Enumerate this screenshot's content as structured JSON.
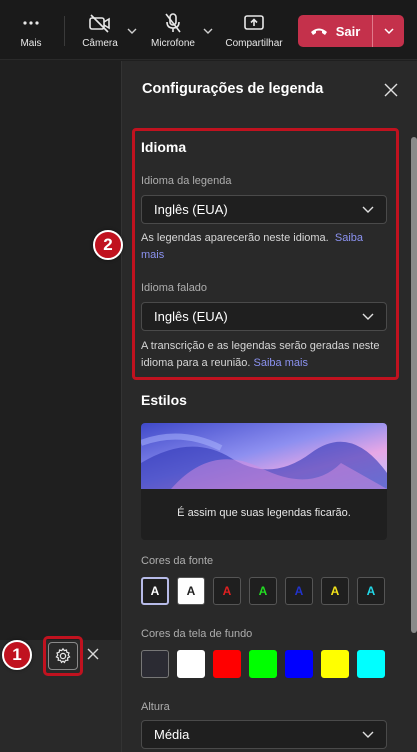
{
  "toolbar": {
    "more_label": "Mais",
    "camera_label": "Câmera",
    "mic_label": "Microfone",
    "share_label": "Compartilhar",
    "leave_label": "Sair"
  },
  "panel": {
    "title": "Configurações de legenda",
    "language": {
      "section_title": "Idioma",
      "caption_lang_label": "Idioma da legenda",
      "caption_lang_value": "Inglês (EUA)",
      "caption_help": "As legendas aparecerão neste idioma.",
      "caption_help_link": "Saiba mais",
      "spoken_lang_label": "Idioma falado",
      "spoken_lang_value": "Inglês (EUA)",
      "spoken_help": "A transcrição e as legendas serão geradas neste idioma para a reunião.",
      "spoken_help_link": "Saiba mais"
    },
    "styles": {
      "section_title": "Estilos",
      "preview_text": "É assim que suas legendas ficarão.",
      "font_colors_label": "Cores da fonte",
      "font_colors": [
        {
          "letter": "A",
          "color": "#ffffff",
          "selected": true
        },
        {
          "letter": "A",
          "color": "#222222",
          "bg": "#ffffff",
          "selected": false
        },
        {
          "letter": "A",
          "color": "#e02020",
          "selected": false
        },
        {
          "letter": "A",
          "color": "#22dd22",
          "selected": false
        },
        {
          "letter": "A",
          "color": "#2233cc",
          "selected": false
        },
        {
          "letter": "A",
          "color": "#f2e21a",
          "selected": false
        },
        {
          "letter": "A",
          "color": "#22d8e8",
          "selected": false
        }
      ],
      "bg_colors_label": "Cores da tela de fundo",
      "bg_colors": [
        "#2b2b33",
        "#ffffff",
        "#ff0000",
        "#00ff00",
        "#0000ff",
        "#ffff00",
        "#00ffff"
      ],
      "height_label": "Altura",
      "height_value": "Média"
    }
  },
  "callouts": {
    "badge_1": "1",
    "badge_2": "2",
    "highlight_color": "#c0121f"
  }
}
